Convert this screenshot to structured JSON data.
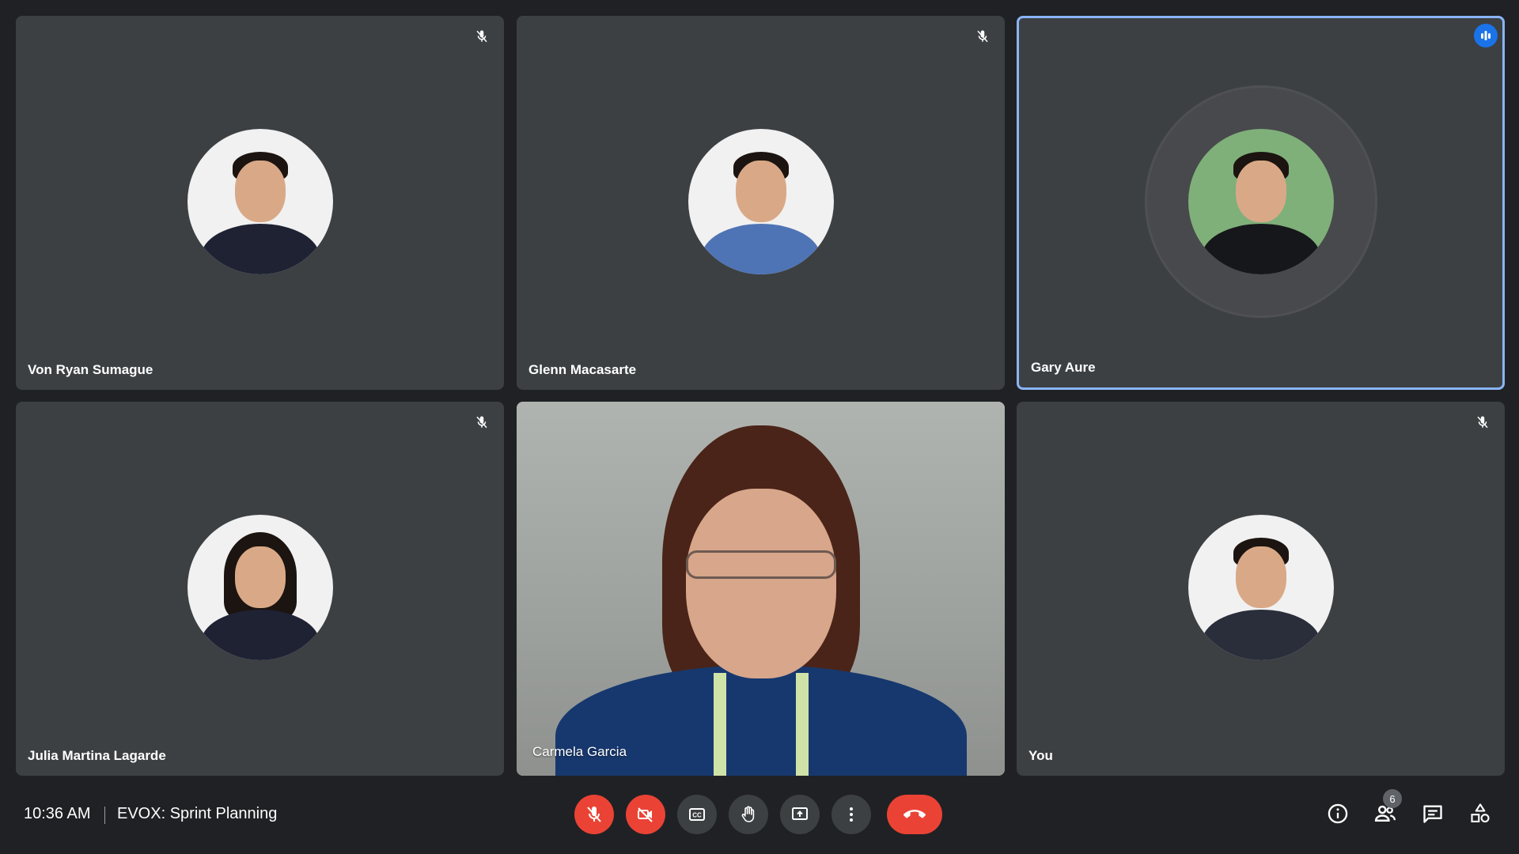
{
  "participants": [
    {
      "name": "Von Ryan Sumague",
      "muted": true
    },
    {
      "name": "Glenn Macasarte",
      "muted": true
    },
    {
      "name": "Gary Aure",
      "speaking": true
    },
    {
      "name": "Julia Martina Lagarde",
      "muted": true
    },
    {
      "name": "Carmela Garcia",
      "camera_on": true
    },
    {
      "name": "You",
      "muted": true
    }
  ],
  "footer": {
    "time": "10:36 AM",
    "meeting_title": "EVOX: Sprint Planning",
    "people_count": "6"
  },
  "icons": {
    "mic": "microphone-off-icon",
    "cam": "camera-off-icon",
    "cc": "closed-captions-icon",
    "hand": "raise-hand-icon",
    "present": "present-screen-icon",
    "more": "more-options-icon",
    "end": "end-call-icon",
    "info": "info-icon",
    "people": "people-icon",
    "chat": "chat-icon",
    "activities": "activities-icon"
  },
  "colors": {
    "background": "#202124",
    "tile": "#3c4043",
    "accent_blue": "#1a73e8",
    "speaking_border": "#8ab4f8",
    "danger_red": "#ea4335"
  }
}
